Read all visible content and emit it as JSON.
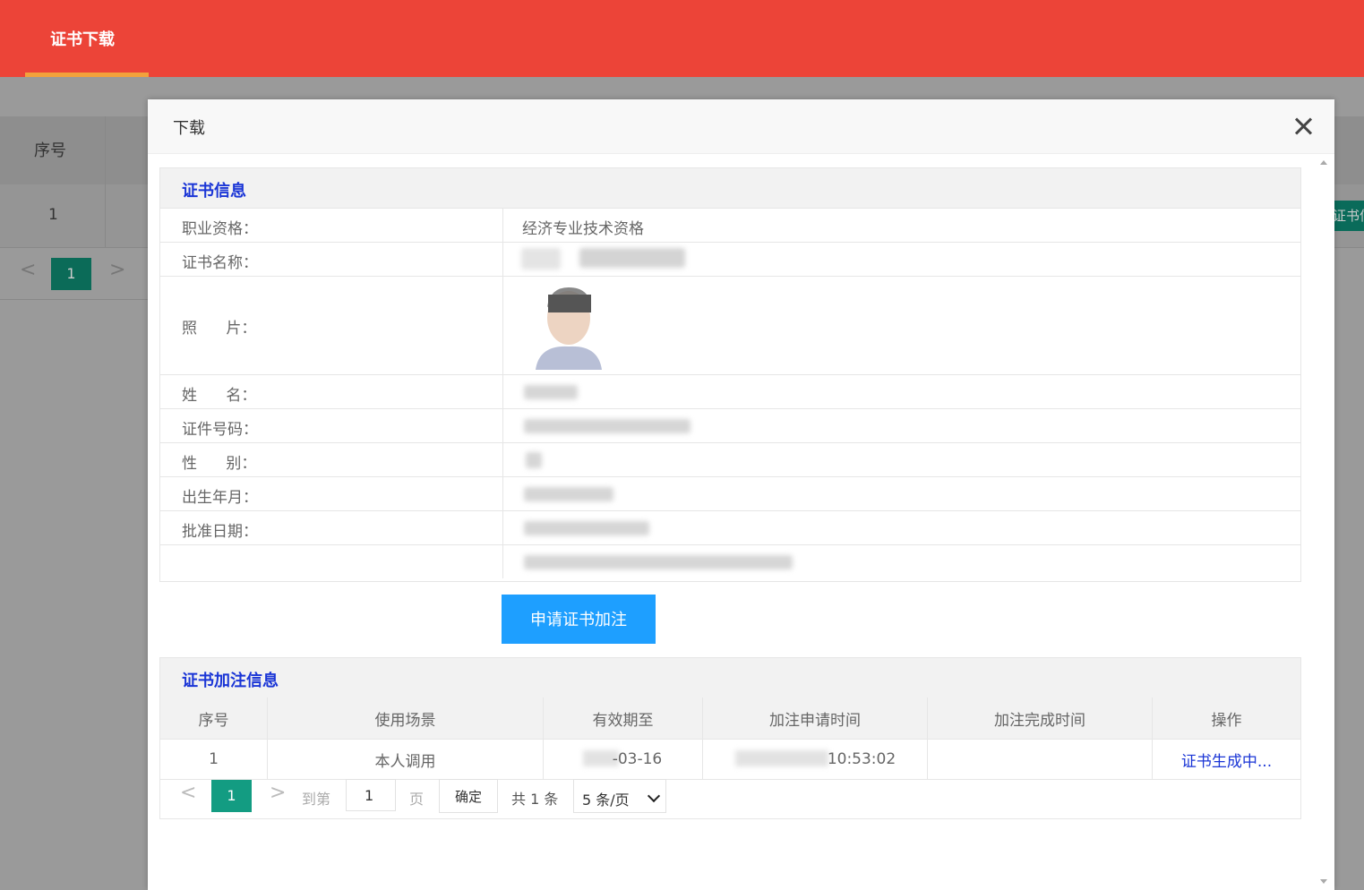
{
  "header": {
    "active_tab": "证书下载"
  },
  "background": {
    "col_index": "序号",
    "row_index": "1",
    "right_button": "证书信",
    "page_prev": "<",
    "page_current": "1",
    "page_next": ">"
  },
  "modal": {
    "title": "下载",
    "certificate_section": {
      "title": "证书信息",
      "rows": [
        {
          "label": "职业资格：",
          "value": "经济专业技术资格"
        },
        {
          "label": "证书名称：",
          "value": ""
        },
        {
          "label": "照      片：",
          "value": ""
        },
        {
          "label": "姓      名：",
          "value": ""
        },
        {
          "label": "证件号码：",
          "value": ""
        },
        {
          "label": "性      别：",
          "value": ""
        },
        {
          "label": "出生年月：",
          "value": ""
        },
        {
          "label": "批准日期：",
          "value": ""
        },
        {
          "label": "",
          "value": ""
        }
      ]
    },
    "apply_button": "申请证书加注",
    "annotation_section": {
      "title": "证书加注信息",
      "columns": [
        "序号",
        "使用场景",
        "有效期至",
        "加注申请时间",
        "加注完成时间",
        "操作"
      ],
      "rows": [
        {
          "index": "1",
          "scene": "本人调用",
          "valid_until": "-03-16",
          "apply_time": "10:53:02",
          "complete_time": "",
          "action": "证书生成中..."
        }
      ]
    },
    "pagination": {
      "prev": "<",
      "current": "1",
      "next": ">",
      "goto_label": "到第",
      "goto_value": "1",
      "page_label": "页",
      "confirm": "确定",
      "total": "共 1 条",
      "page_size": "5 条/页"
    }
  }
}
